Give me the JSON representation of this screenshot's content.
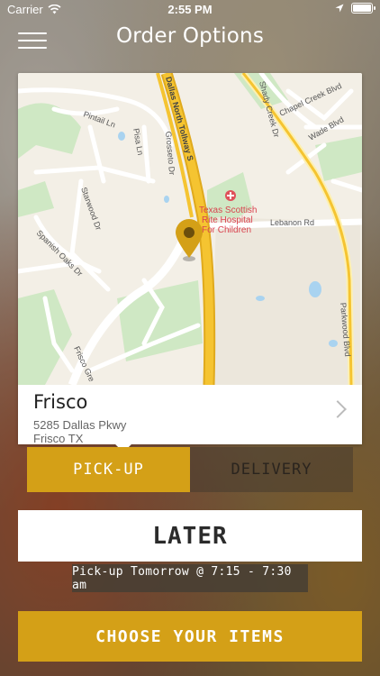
{
  "status_bar": {
    "carrier": "Carrier",
    "time": "2:55 PM",
    "icons": [
      "wifi-icon",
      "location-arrow-icon",
      "battery-icon"
    ]
  },
  "nav": {
    "title": "Order Options",
    "menu_icon": "hamburger-menu-icon"
  },
  "map": {
    "street_labels": {
      "dallas_tollway": "Dallas North Tollway S",
      "pintail": "Pintail Ln",
      "pisa": "Pisa Ln",
      "grosseto": "Grosseto Dr",
      "starwood": "Starwood Dr",
      "spanish_oaks": "Spanish Oaks Dr",
      "frisco_green": "Frisco Gre",
      "shady_creek": "Shady Creek Dr",
      "chapel_creek": "Chapel Creek Blvd",
      "wade": "Wade Blvd",
      "lebanon": "Lebanon Rd",
      "parkwood": "Parkwood Blvd"
    },
    "hospital_lines": [
      "Texas Scottish",
      "Rite Hospital",
      "For Children"
    ],
    "pin_icon": "map-pin-icon",
    "hospital_icon": "hospital-icon",
    "colors": {
      "major_road": "#f5c431",
      "land": "#f3efe6",
      "park": "#cfe8c4",
      "water": "#a9d3f0"
    }
  },
  "store": {
    "name": "Frisco",
    "address_line1": "5285 Dallas Pkwy",
    "address_line2": "Frisco TX"
  },
  "order_type": {
    "pickup_label": "PICK-UP",
    "delivery_label": "DELIVERY",
    "selected": "pickup"
  },
  "timing": {
    "later_label": "LATER",
    "pickup_time_text": "Pick-up Tomorrow @ 7:15 - 7:30 am"
  },
  "actions": {
    "choose_label": "CHOOSE YOUR ITEMS"
  },
  "colors": {
    "accent": "#d4a017",
    "card": "#ffffff"
  }
}
